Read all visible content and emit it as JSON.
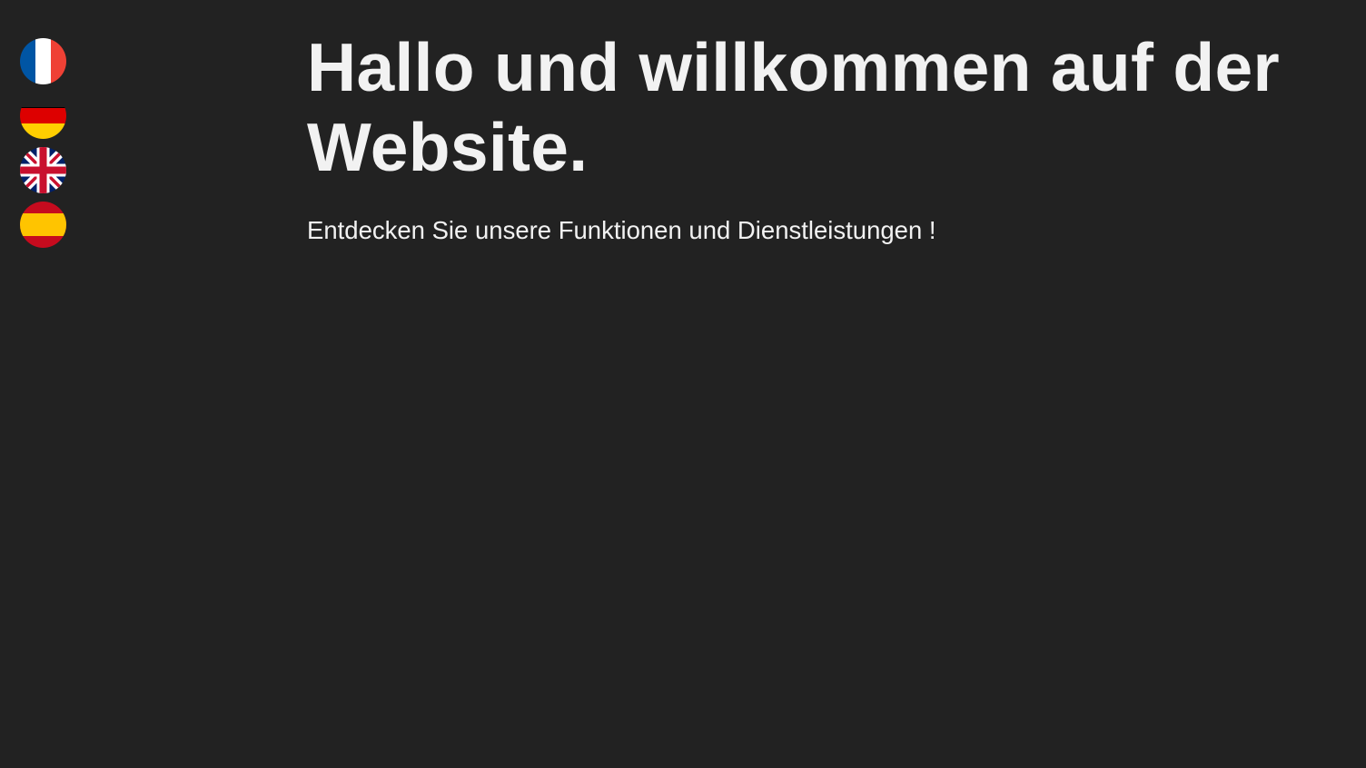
{
  "language_switcher": {
    "flags": [
      {
        "icon": "france-flag-icon",
        "colors": [
          "#0055A4",
          "#FFFFFF",
          "#EF4135"
        ]
      },
      {
        "icon": "germany-flag-icon",
        "colors": [
          "#000000",
          "#DD0000",
          "#FFCE00"
        ]
      },
      {
        "icon": "uk-flag-icon",
        "colors": [
          "#012169",
          "#FFFFFF",
          "#C8102E"
        ]
      },
      {
        "icon": "spain-flag-icon",
        "colors": [
          "#C60B1E",
          "#FFC400"
        ]
      }
    ]
  },
  "hero": {
    "title": "Hallo und willkommen auf der Website.",
    "subtitle": "Entdecken Sie unsere Funktionen und Dienstleistungen !"
  },
  "theme": {
    "background": "#222222",
    "text": "#F2F2F2"
  }
}
